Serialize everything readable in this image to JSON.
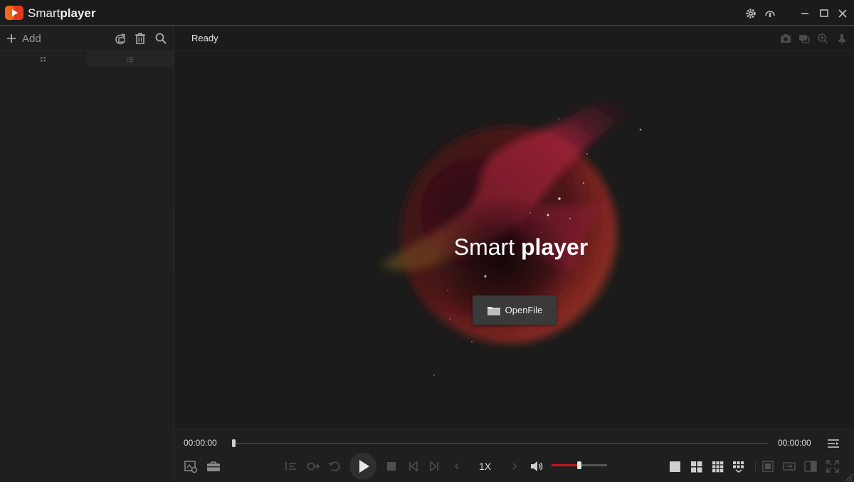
{
  "app": {
    "title_light": "Smart",
    "title_bold": "player"
  },
  "titlebar": {
    "icons": [
      "settings-icon",
      "support-icon",
      "minimize-icon",
      "maximize-icon",
      "close-icon"
    ]
  },
  "sidebar": {
    "add_label": "Add",
    "toolbar_icons": [
      "refresh-icon",
      "trash-icon",
      "search-icon"
    ],
    "tabs": [
      "grid-view-icon",
      "list-view-icon"
    ]
  },
  "main": {
    "status": "Ready",
    "toolbar_icons": [
      "screenshot-icon",
      "subtitle-icon",
      "zoom-icon",
      "pin-icon"
    ]
  },
  "splash": {
    "title_light": "Smart ",
    "title_bold": "player",
    "open_file_label": "OpenFile"
  },
  "controls": {
    "current_time": "00:00:00",
    "total_time": "00:00:00",
    "progress": 0,
    "speed": "1X",
    "volume": 0.5
  },
  "colors": {
    "accent": "#c8161e",
    "background": "#1b1b1b",
    "sidebar": "#1f1f1f"
  }
}
